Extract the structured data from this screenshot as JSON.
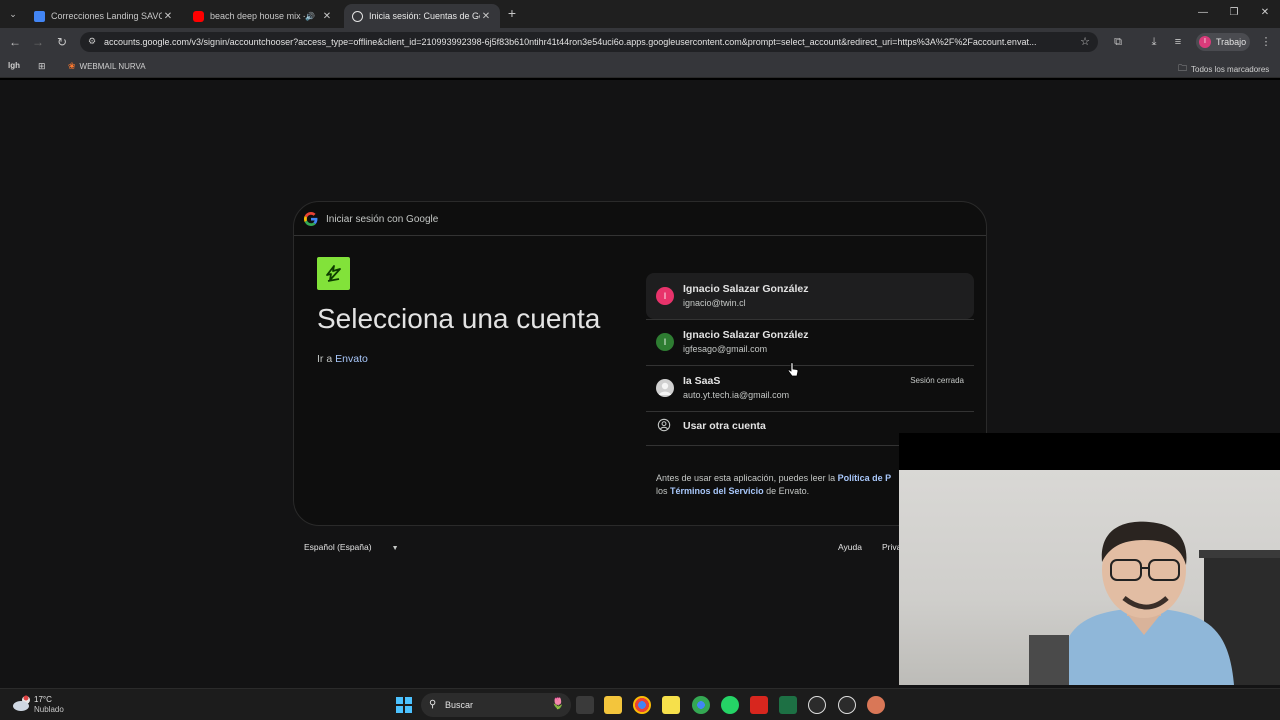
{
  "browser": {
    "tabs": [
      {
        "title": "Correcciones Landing SAVOUR",
        "favicon_color": "#4285f4",
        "active": false
      },
      {
        "title": "beach deep house mix - YouTube",
        "favicon_color": "#ff0000",
        "active": false,
        "audio": true
      },
      {
        "title": "Inicia sesión: Cuentas de Google",
        "favicon_color": "#e3e3e3",
        "active": true
      }
    ],
    "new_tab_symbol": "+",
    "window_controls": {
      "minimize": "—",
      "restore": "❐",
      "close": "✕"
    },
    "url": "accounts.google.com/v3/signin/accountchooser?access_type=offline&client_id=210993992398-6j5f83b610ntihr41t44ron3e54uci6o.apps.googleusercontent.com&prompt=select_account&redirect_uri=https%3A%2F%2Faccount.envat...",
    "profile": {
      "initial": "I",
      "name": "Trabajo",
      "color": "#d93b7a"
    },
    "bookmarks": [
      {
        "label": "lgh",
        "icon": "bookmark-icon"
      },
      {
        "label": "",
        "icon": "apps-grid-icon"
      },
      {
        "label": "WEBMAIL NURVA",
        "icon": "webmail-icon"
      }
    ],
    "all_bookmarks": "Todos los marcadores"
  },
  "signin": {
    "header": "Iniciar sesión con Google",
    "title": "Selecciona una cuenta",
    "goto_prefix": "Ir a",
    "goto_app": "Envato",
    "accounts": [
      {
        "initial": "I",
        "name": "Ignacio Salazar González",
        "email": "ignacio@twin.cl",
        "color": "#e8336b",
        "status": ""
      },
      {
        "initial": "I",
        "name": "Ignacio Salazar González",
        "email": "igfesago@gmail.com",
        "color": "#2e7d32",
        "status": ""
      },
      {
        "initial": "",
        "name": "Ia SaaS",
        "email": "auto.yt.tech.ia@gmail.com",
        "color": "#d0d0d0",
        "status": "Sesión cerrada"
      }
    ],
    "other_account": "Usar otra cuenta",
    "policy": {
      "before": "Antes de usar esta aplicación, puedes leer la",
      "privacy_link": "Política de P",
      "and_the": "los",
      "terms_link": "Términos del Servicio",
      "after": "de Envato."
    }
  },
  "footer": {
    "language": "Español (España)",
    "help": "Ayuda",
    "privacy": "Priva"
  },
  "taskbar": {
    "weather_temp": "17°C",
    "weather_desc": "Nublado",
    "search_label": "Buscar"
  }
}
